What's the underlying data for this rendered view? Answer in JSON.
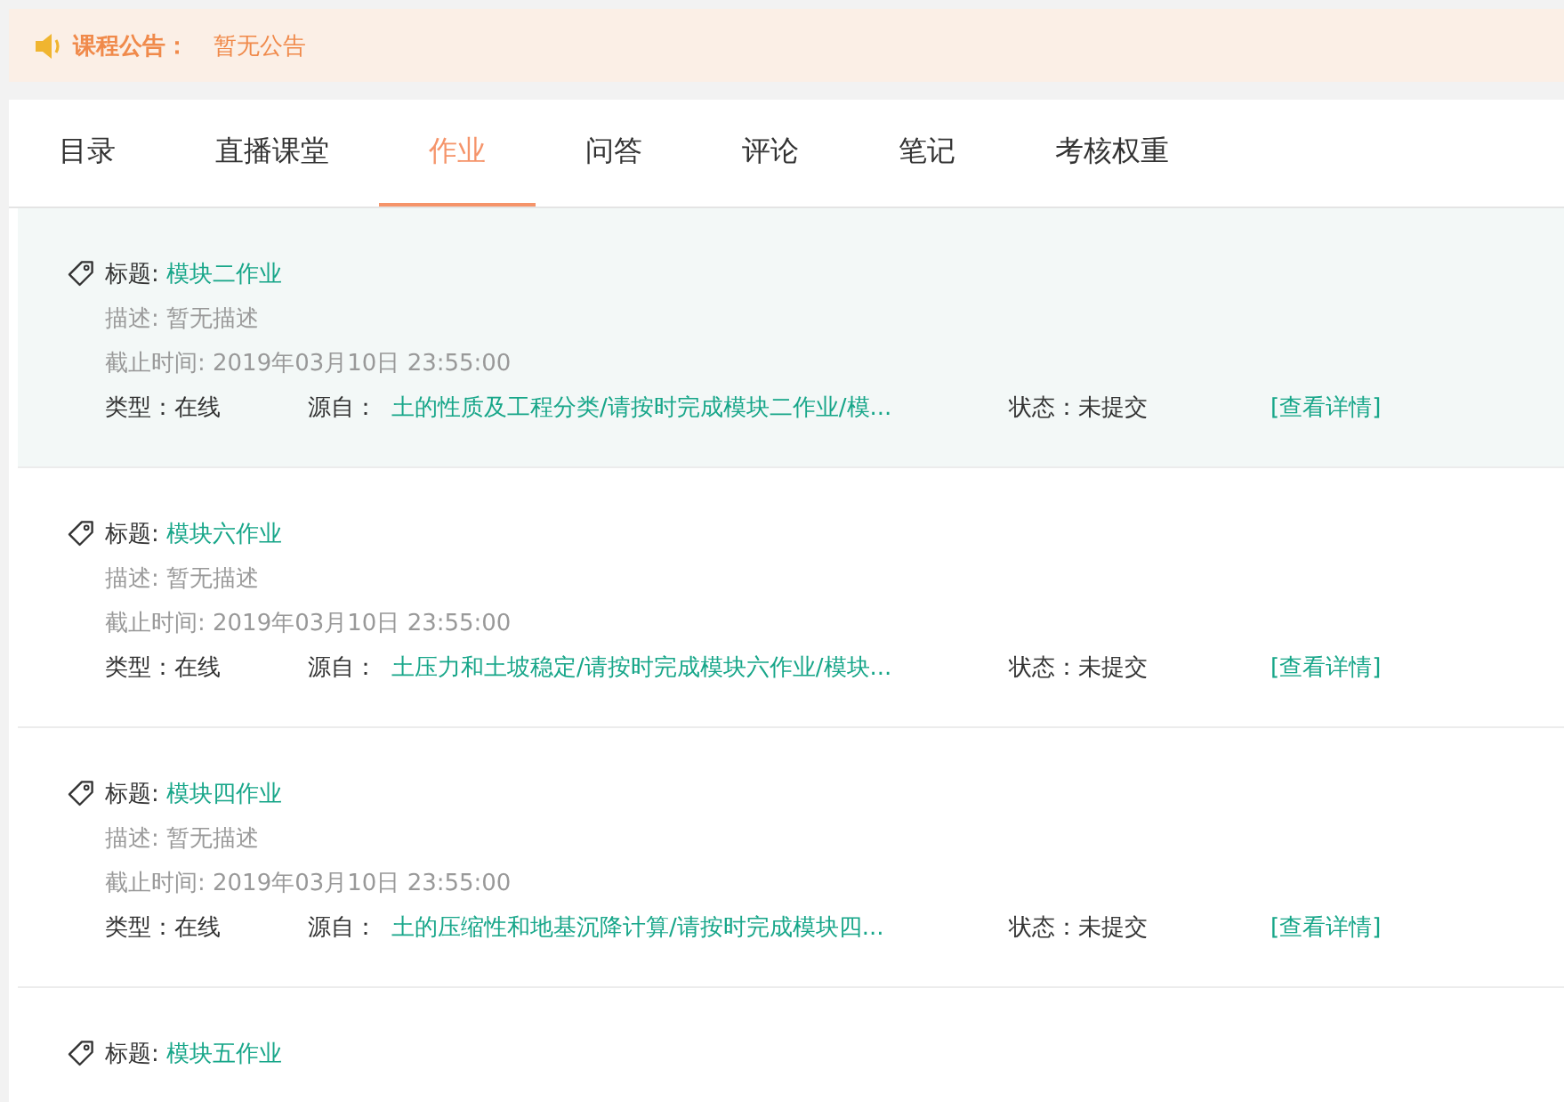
{
  "notice": {
    "label": "课程公告：",
    "text": "暂无公告"
  },
  "tabs": [
    {
      "label": "目录",
      "selected": false
    },
    {
      "label": "直播课堂",
      "selected": false
    },
    {
      "label": "作业",
      "selected": true
    },
    {
      "label": "问答",
      "selected": false
    },
    {
      "label": "评论",
      "selected": false
    },
    {
      "label": "笔记",
      "selected": false
    },
    {
      "label": "考核权重",
      "selected": false
    }
  ],
  "assignments": [
    {
      "selected": true,
      "title_label": "标题:",
      "title": "模块二作业",
      "description": "描述: 暂无描述",
      "deadline": "截止时间: 2019年03月10日 23:55:00",
      "type_label": "类型：",
      "type": "在线",
      "source_label": "源自：",
      "source": "土的性质及工程分类/请按时完成模块二作业/模...",
      "status_label": "状态：",
      "status": "未提交",
      "link": "[查看详情]"
    },
    {
      "selected": false,
      "title_label": "标题:",
      "title": "模块六作业",
      "description": "描述: 暂无描述",
      "deadline": "截止时间: 2019年03月10日 23:55:00",
      "type_label": "类型：",
      "type": "在线",
      "source_label": "源自：",
      "source": "土压力和土坡稳定/请按时完成模块六作业/模块...",
      "status_label": "状态：",
      "status": "未提交",
      "link": "[查看详情]"
    },
    {
      "selected": false,
      "title_label": "标题:",
      "title": "模块四作业",
      "description": "描述: 暂无描述",
      "deadline": "截止时间: 2019年03月10日 23:55:00",
      "type_label": "类型：",
      "type": "在线",
      "source_label": "源自：",
      "source": "土的压缩性和地基沉降计算/请按时完成模块四...",
      "status_label": "状态：",
      "status": "未提交",
      "link": "[查看详情]"
    },
    {
      "selected": false,
      "title_label": "标题:",
      "title": "模块五作业"
    }
  ]
}
